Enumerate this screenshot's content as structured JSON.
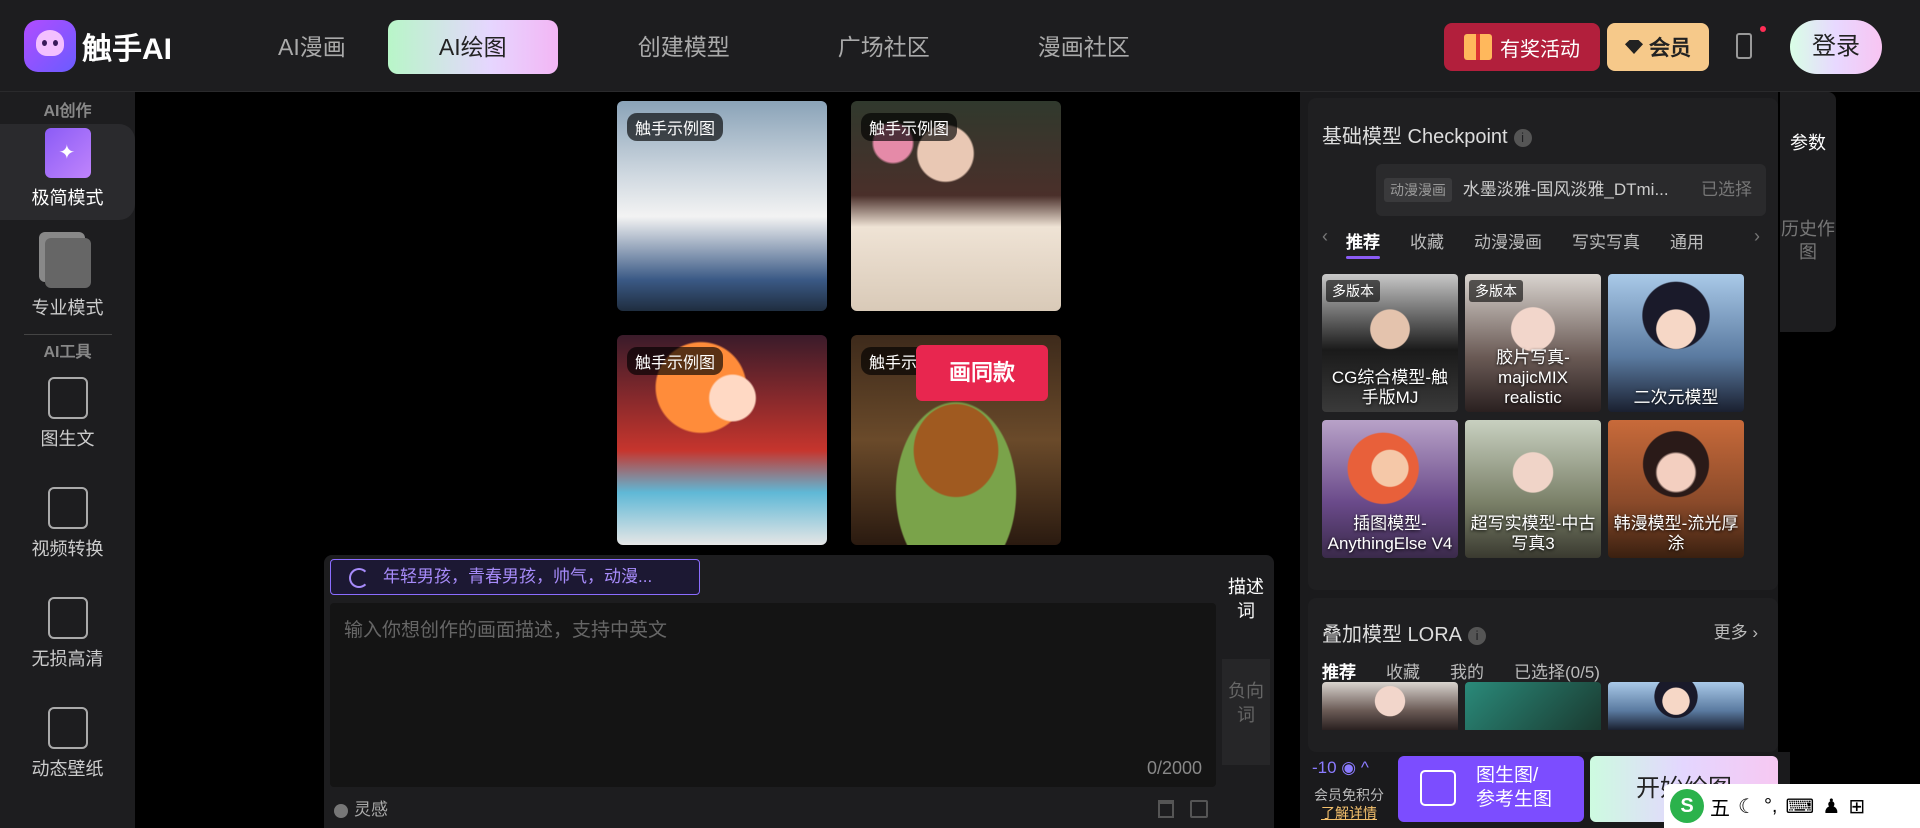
{
  "header": {
    "brand": "触手AI",
    "nav": [
      "AI漫画",
      "AI绘图",
      "创建模型",
      "广场社区",
      "漫画社区"
    ],
    "promo": "有奖活动",
    "vip": "会员",
    "login": "登录"
  },
  "sidebar": {
    "section1": "AI创作",
    "items1": [
      "极简模式",
      "专业模式"
    ],
    "section2": "AI工具",
    "items2": [
      "图生文",
      "视频转换",
      "无损高清",
      "动态壁纸"
    ]
  },
  "gallery": {
    "tag": "触手示例图",
    "same_style": "画同款"
  },
  "prompt": {
    "suggestion": "年轻男孩，青春男孩，帅气，动漫...",
    "placeholder": "输入你想创作的画面描述，支持中英文",
    "counter": "0/2000",
    "tab_desc": "描述词",
    "tab_neg": "负向词",
    "inspiration": "灵感"
  },
  "checkpoint": {
    "title": "基础模型 Checkpoint",
    "selected_tag": "动漫漫画",
    "selected_name": "水墨淡雅-国风淡雅_DTmi...",
    "selected_state": "已选择",
    "tabs": [
      "推荐",
      "收藏",
      "动漫漫画",
      "写实写真",
      "通用"
    ],
    "models": [
      {
        "badge": "多版本",
        "label": "CG综合模型-触手版MJ"
      },
      {
        "badge": "多版本",
        "label": "胶片写真-majicMIX realistic"
      },
      {
        "badge": "",
        "label": "二次元模型"
      },
      {
        "badge": "",
        "label": "插图模型-AnythingElse V4"
      },
      {
        "badge": "",
        "label": "超写实模型-中古写真3"
      },
      {
        "badge": "",
        "label": "韩漫模型-流光厚涂"
      }
    ]
  },
  "lora": {
    "title": "叠加模型 LORA",
    "more": "更多",
    "tabs": [
      "推荐",
      "收藏",
      "我的",
      "已选择(0/5)"
    ]
  },
  "actions": {
    "credit": "-10",
    "note1": "会员免积分",
    "note2": "了解详情",
    "img2img": "图生图/参考生图",
    "img2img_line1": "图生图/",
    "img2img_line2": "参考生图",
    "start": "开始绘图"
  },
  "right_tabs": [
    "参数",
    "历史作图"
  ],
  "ime": {
    "mode": "五",
    "keys": [
      "☾",
      "°,",
      "⌨",
      "♟",
      "⊞"
    ]
  }
}
